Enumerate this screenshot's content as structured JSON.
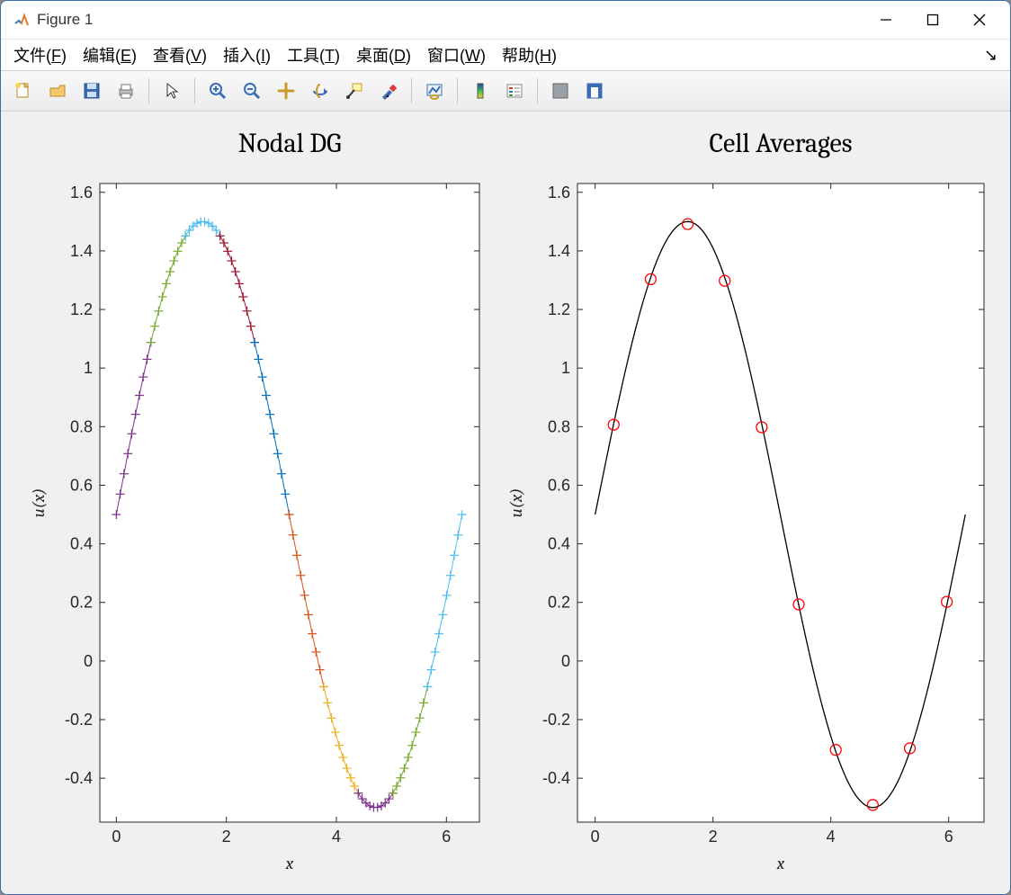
{
  "window": {
    "title": "Figure 1"
  },
  "menus": [
    {
      "label": "文件",
      "mn": "F"
    },
    {
      "label": "编辑",
      "mn": "E"
    },
    {
      "label": "查看",
      "mn": "V"
    },
    {
      "label": "插入",
      "mn": "I"
    },
    {
      "label": "工具",
      "mn": "T"
    },
    {
      "label": "桌面",
      "mn": "D"
    },
    {
      "label": "窗口",
      "mn": "W"
    },
    {
      "label": "帮助",
      "mn": "H"
    }
  ],
  "toolbar": [
    {
      "name": "new-figure-icon",
      "kind": "new"
    },
    {
      "name": "open-icon",
      "kind": "open"
    },
    {
      "name": "save-icon",
      "kind": "save"
    },
    {
      "name": "print-icon",
      "kind": "print"
    },
    {
      "sep": true
    },
    {
      "name": "pointer-icon",
      "kind": "pointer"
    },
    {
      "sep": true
    },
    {
      "name": "zoom-in-icon",
      "kind": "zoomin"
    },
    {
      "name": "zoom-out-icon",
      "kind": "zoomout"
    },
    {
      "name": "pan-icon",
      "kind": "pan"
    },
    {
      "name": "rotate3d-icon",
      "kind": "rotate3d"
    },
    {
      "name": "datatip-icon",
      "kind": "datatip"
    },
    {
      "name": "brush-icon",
      "kind": "brush"
    },
    {
      "sep": true
    },
    {
      "name": "link-icon",
      "kind": "link"
    },
    {
      "sep": true
    },
    {
      "name": "colorbar-icon",
      "kind": "colorbar"
    },
    {
      "name": "legend-icon",
      "kind": "legend"
    },
    {
      "sep": true
    },
    {
      "name": "hide-plot-tools-icon",
      "kind": "hidetools"
    },
    {
      "name": "show-plot-tools-icon",
      "kind": "showtools"
    }
  ],
  "chart_data": [
    {
      "type": "line",
      "title": "Nodal DG",
      "xlabel": "x",
      "ylabel": "u(x)",
      "xlim": [
        -0.3,
        6.6
      ],
      "xticks": [
        0,
        2,
        4,
        6
      ],
      "ylim": [
        -0.55,
        1.63
      ],
      "yticks": [
        -0.4,
        -0.2,
        0,
        0.2,
        0.4,
        0.6,
        0.8,
        1,
        1.2,
        1.4,
        1.6
      ],
      "segments": 10,
      "nodes_per_segment": 10,
      "domain": [
        0,
        6.2832
      ],
      "function": "0.5 + sin(x)",
      "marker": "+",
      "segment_colors": [
        "#7e2f8e",
        "#77ac30",
        "#4dbeee",
        "#a2142f",
        "#0072bd",
        "#d95319",
        "#edb120",
        "#7e2f8e",
        "#77ac30",
        "#4dbeee"
      ]
    },
    {
      "type": "line",
      "title": "Cell Averages",
      "xlabel": "x",
      "ylabel": "u(x)",
      "xlim": [
        -0.3,
        6.6
      ],
      "xticks": [
        0,
        2,
        4,
        6
      ],
      "ylim": [
        -0.55,
        1.63
      ],
      "yticks": [
        -0.4,
        -0.2,
        0,
        0.2,
        0.4,
        0.6,
        0.8,
        1,
        1.2,
        1.4,
        1.6
      ],
      "continuous_curve": {
        "domain": [
          0,
          6.2832
        ],
        "function": "0.5 + sin(x)",
        "color": "#000000"
      },
      "averages": {
        "x": [
          0.3142,
          0.9425,
          1.5708,
          2.1991,
          2.8274,
          3.4558,
          4.0841,
          4.7124,
          5.3407,
          5.969
        ],
        "y": [
          0.8067,
          1.3034,
          1.4914,
          1.298,
          0.7979,
          0.1933,
          -0.3034,
          -0.4914,
          -0.298,
          0.2021
        ],
        "marker": "o",
        "marker_color": "#ff0000"
      }
    }
  ]
}
